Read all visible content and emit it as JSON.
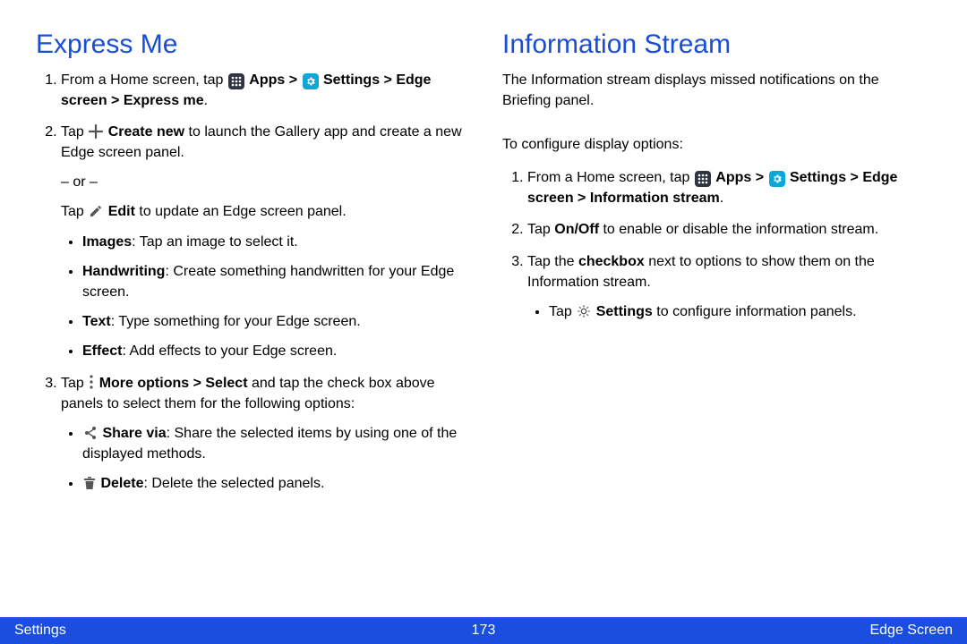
{
  "left": {
    "heading": "Express Me",
    "step1_from": "From a Home screen, tap ",
    "step1_apps": " Apps > ",
    "step1_settings": " Settings > Edge screen > Express me",
    "step1_period": ".",
    "step2_tap": "Tap ",
    "step2_createnew": " Create new",
    "step2_tail": " to launch the Gallery app and create a new Edge screen panel.",
    "or": "– or –",
    "step2_tap2": "Tap ",
    "step2_edit": " Edit",
    "step2_edit_tail": " to update an Edge screen panel.",
    "bul_images_b": "Images",
    "bul_images_t": ": Tap an image to select it.",
    "bul_hand_b": "Handwriting",
    "bul_hand_t": ": Create something handwritten for your Edge screen.",
    "bul_text_b": "Text",
    "bul_text_t": ": Type something for your Edge screen.",
    "bul_effect_b": "Effect",
    "bul_effect_t": ": Add effects to your Edge screen.",
    "step3_tap": "Tap ",
    "step3_more": " More options > Select",
    "step3_tail": " and tap the check box above panels to select them for the following options:",
    "bul_share_b": " Share via",
    "bul_share_t": ": Share the selected items by using one of the displayed methods.",
    "bul_del_b": " Delete",
    "bul_del_t": ": Delete the selected panels."
  },
  "right": {
    "heading": "Information Stream",
    "intro": "The Information stream displays missed notifications on the Briefing panel.",
    "config": "To configure display options:",
    "step1_from": "From a Home screen, tap ",
    "step1_apps": " Apps > ",
    "step1_settings": " Settings > Edge screen > Information stream",
    "step1_period": ".",
    "step2_tap": "Tap ",
    "step2_onoff": "On/Off",
    "step2_tail": " to enable or disable the information stream.",
    "step3_tap": "Tap the ",
    "step3_check": "checkbox",
    "step3_tail": " next to options to show them on the Information stream.",
    "bul_set_head": "Tap ",
    "bul_set_b": " Settings",
    "bul_set_t": " to configure information panels."
  },
  "footer": {
    "left": "Settings",
    "center": "173",
    "right": "Edge Screen"
  }
}
